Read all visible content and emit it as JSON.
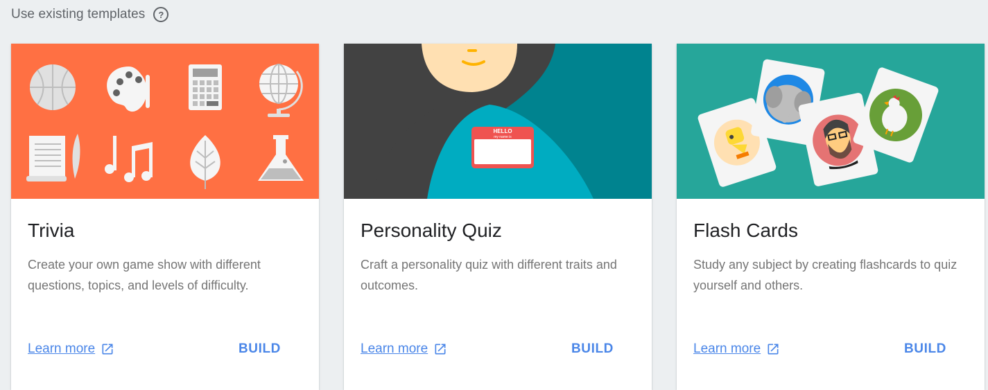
{
  "header": {
    "title": "Use existing templates",
    "help_icon": "?"
  },
  "cards": [
    {
      "title": "Trivia",
      "description": "Create your own game show with different questions, topics, and levels of difficulty.",
      "learn_more": "Learn more",
      "build": "BUILD",
      "art_color": "#ff7043"
    },
    {
      "title": "Personality Quiz",
      "description": "Craft a personality quiz with different traits and outcomes.",
      "learn_more": "Learn more",
      "build": "BUILD",
      "art_color": "#00838f",
      "name_tag": {
        "hello": "HELLO",
        "subtitle": "my name is"
      }
    },
    {
      "title": "Flash Cards",
      "description": "Study any subject by creating flashcards to quiz yourself and others.",
      "learn_more": "Learn more",
      "build": "BUILD",
      "art_color": "#26a69a"
    }
  ],
  "colors": {
    "link": "#4a86e8",
    "page_background": "#eceff1"
  }
}
